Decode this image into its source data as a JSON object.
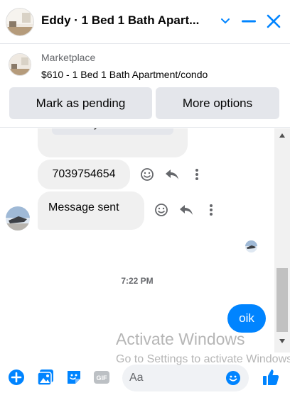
{
  "header": {
    "title": "Eddy · 1 Bed 1 Bath Apart...",
    "accent": "#0084ff"
  },
  "marketplace": {
    "label": "Marketplace",
    "listing": "$610 - 1 Bed 1 Bath Apartment/condo",
    "mark_pending_label": "Mark as pending",
    "more_options_label": "More options"
  },
  "messages": {
    "buyer_details_label": "Buyer details",
    "phone": "7039754654",
    "message_sent": "Message sent",
    "timestamp": "7:22 PM",
    "outgoing": "oik"
  },
  "watermark": {
    "line1": "Activate Windows",
    "line2": "Go to Settings to activate Windows."
  },
  "composer": {
    "placeholder": "Aa",
    "gif_label": "GIF"
  }
}
